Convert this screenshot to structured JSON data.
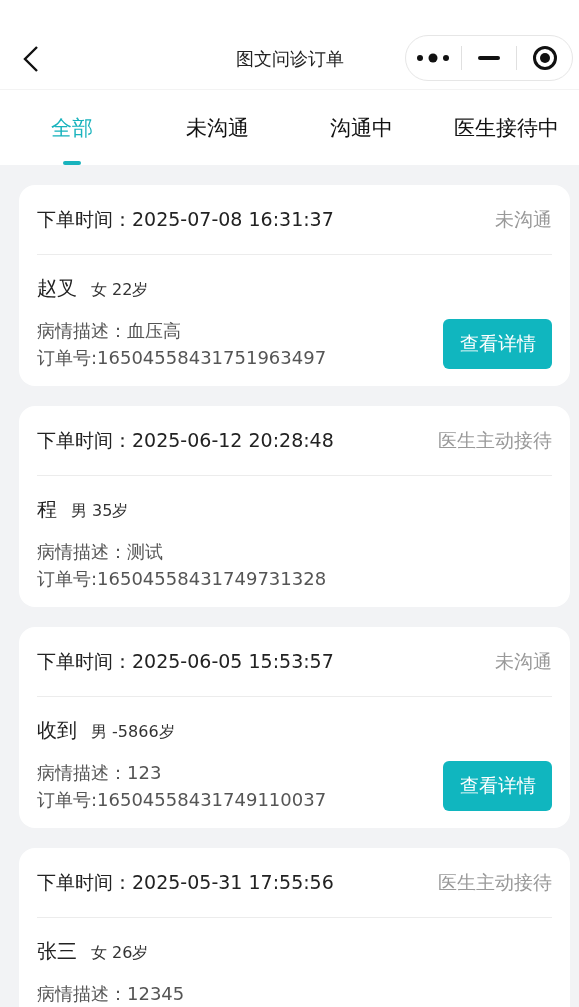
{
  "nav_bar": {
    "title": "图文问诊订单"
  },
  "tabs": [
    {
      "label": "全部",
      "selected": true
    },
    {
      "label": "未沟通",
      "selected": false
    },
    {
      "label": "沟通中",
      "selected": false
    },
    {
      "label": "医生接待中",
      "selected": false
    }
  ],
  "orders": [
    {
      "time_label": "下单时间：",
      "time": "2025-07-08 16:31:37",
      "status": "未沟通",
      "name": "赵叉",
      "gender_age": "女 22岁",
      "description": "病情描述：血压高",
      "order_no": "订单号:16504558431751963497",
      "button": "查看详情"
    },
    {
      "time_label": "下单时间：",
      "time": "2025-06-12 20:28:48",
      "status": "医生主动接待",
      "name": "程",
      "gender_age": "男 35岁",
      "description": "病情描述：测试",
      "order_no": "订单号:16504558431749731328"
    },
    {
      "time_label": "下单时间：",
      "time": "2025-06-05 15:53:57",
      "status": "未沟通",
      "name": "收到",
      "gender_age": "男 -5866岁",
      "description": "病情描述：123",
      "order_no": "订单号:16504558431749110037",
      "button": "查看详情"
    },
    {
      "time_label": "下单时间：",
      "time": "2025-05-31 17:55:56",
      "status": "医生主动接待",
      "name": "张三",
      "gender_age": "女 26岁",
      "description": "病情描述：12345"
    }
  ]
}
